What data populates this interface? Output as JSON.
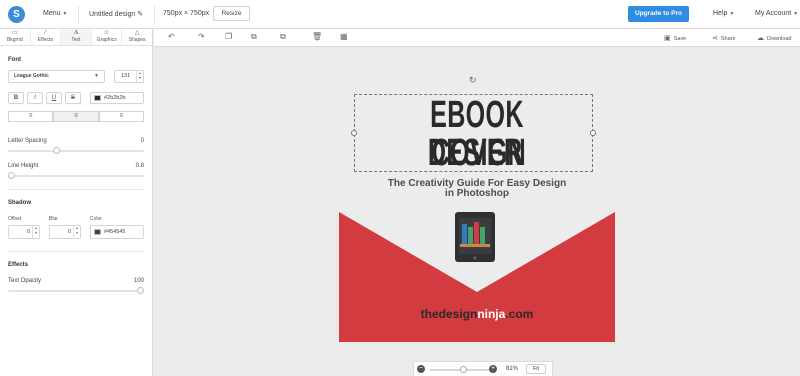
{
  "header": {
    "logo_letter": "S",
    "menu_label": "Menu",
    "doc_title": "Untitled design",
    "doc_size": "750px × 750px",
    "resize_label": "Resize",
    "upgrade_label": "Upgrade to Pro",
    "help_label": "Help",
    "account_label": "My Account",
    "colors": {
      "upgrade": "#2f8ce0"
    }
  },
  "tabs": [
    {
      "label": "Bkgrnd",
      "icon": "image-icon"
    },
    {
      "label": "Effects",
      "icon": "wand-icon"
    },
    {
      "label": "Text",
      "icon": "text-icon",
      "glyph": "A"
    },
    {
      "label": "Graphics",
      "icon": "graphics-icon"
    },
    {
      "label": "Shapes",
      "icon": "shapes-icon"
    }
  ],
  "font": {
    "section_label": "Font",
    "family": "League Gothic",
    "size": "131",
    "styles": [
      "B",
      "I",
      "U",
      "S"
    ],
    "color": "#2b2b2b",
    "align_active": "center"
  },
  "letter_spacing": {
    "label": "Letter Spacing",
    "value": "0",
    "level": 0.35
  },
  "line_height": {
    "label": "Line Height",
    "value": "0.8",
    "level": 0.0
  },
  "shadow": {
    "section_label": "Shadow",
    "offset_label": "Offset",
    "offset_value": "0",
    "blur_label": "Blur",
    "blur_value": "0",
    "color_label": "Color",
    "color_value": "#454545"
  },
  "effects": {
    "section_label": "Effects",
    "opacity_label": "Text Opacity",
    "opacity_value": "100",
    "level": 1.0
  },
  "toolbar": {
    "save_label": "Save",
    "share_label": "Share",
    "download_label": "Download"
  },
  "canvas": {
    "title_line1": "EBOOK COVER",
    "title_line2": "DESIGN",
    "subtitle_line1": "The Creativity Guide For Easy Design",
    "subtitle_line2": "in Photoshop",
    "brand_part1": "thedesign",
    "brand_part2": "ninja",
    "brand_part3": ".com",
    "colors": {
      "background": "#ececec",
      "red": "#d23b3f",
      "title": "#2a2a2a"
    }
  },
  "zoom": {
    "value": "81%",
    "fit_label": "Fit",
    "level": 0.55
  }
}
